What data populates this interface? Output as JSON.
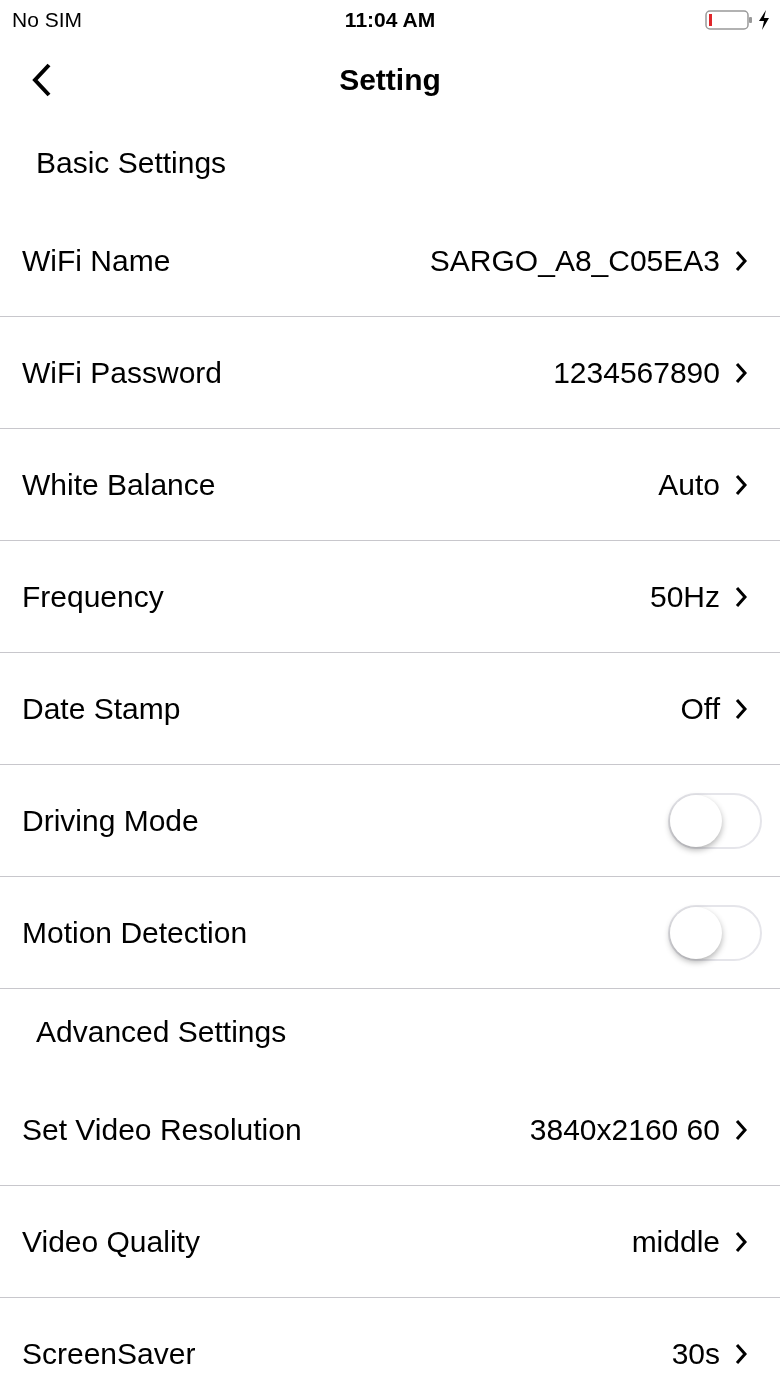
{
  "status_bar": {
    "carrier": "No SIM",
    "time": "11:04 AM",
    "charging": true
  },
  "nav": {
    "title": "Setting"
  },
  "sections": [
    {
      "title": "Basic Settings",
      "rows": [
        {
          "kind": "value",
          "label": "WiFi Name",
          "value": "SARGO_A8_C05EA3"
        },
        {
          "kind": "value",
          "label": "WiFi Password",
          "value": "1234567890"
        },
        {
          "kind": "value",
          "label": "White Balance",
          "value": "Auto"
        },
        {
          "kind": "value",
          "label": "Frequency",
          "value": "50Hz"
        },
        {
          "kind": "value",
          "label": "Date Stamp",
          "value": "Off"
        },
        {
          "kind": "toggle",
          "label": "Driving Mode",
          "on": false
        },
        {
          "kind": "toggle",
          "label": "Motion Detection",
          "on": false
        }
      ]
    },
    {
      "title": "Advanced Settings",
      "rows": [
        {
          "kind": "value",
          "label": "Set Video Resolution",
          "value": "3840x2160 60"
        },
        {
          "kind": "value",
          "label": "Video Quality",
          "value": "middle"
        },
        {
          "kind": "value",
          "label": "ScreenSaver",
          "value": "30s"
        }
      ]
    }
  ]
}
